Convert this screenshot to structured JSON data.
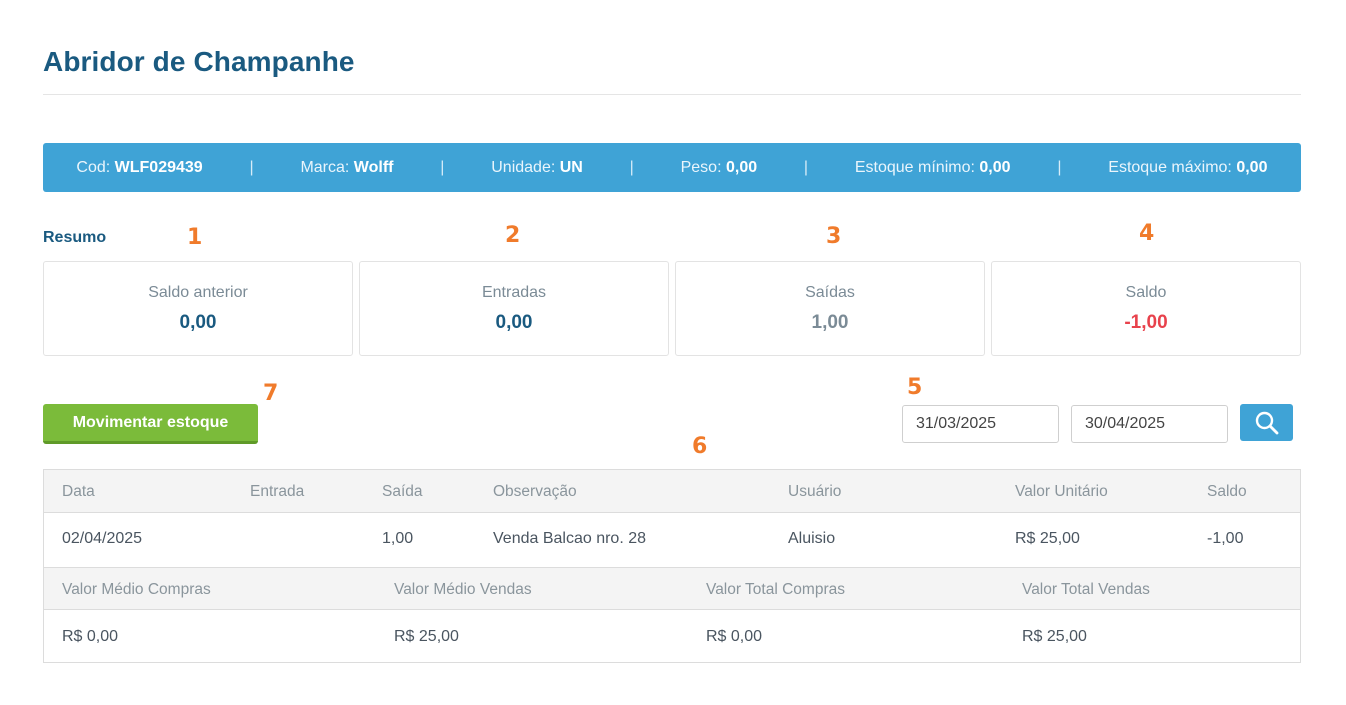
{
  "page": {
    "title": "Abridor de Champanhe"
  },
  "info": {
    "cod_label": "Cod:",
    "cod_value": "WLF029439",
    "marca_label": "Marca:",
    "marca_value": "Wolff",
    "unidade_label": "Unidade:",
    "unidade_value": "UN",
    "peso_label": "Peso:",
    "peso_value": "0,00",
    "min_label": "Estoque mínimo:",
    "min_value": "0,00",
    "max_label": "Estoque máximo:",
    "max_value": "0,00",
    "separator": "|"
  },
  "resumo": {
    "label": "Resumo",
    "cards": [
      {
        "label": "Saldo anterior",
        "value": "0,00",
        "color": "#1a5a80"
      },
      {
        "label": "Entradas",
        "value": "0,00",
        "color": "#1a5a80"
      },
      {
        "label": "Saídas",
        "value": "1,00",
        "color": "#7b8b96"
      },
      {
        "label": "Saldo",
        "value": "-1,00",
        "color": "#e8424c"
      }
    ]
  },
  "markers": [
    "1",
    "2",
    "3",
    "4",
    "5",
    "6",
    "7"
  ],
  "actions": {
    "move_stock": "Movimentar estoque",
    "search_icon": "search-icon"
  },
  "filters": {
    "date_from": "31/03/2025",
    "date_to": "30/04/2025"
  },
  "movements": {
    "headers": [
      "Data",
      "Entrada",
      "Saída",
      "Observação",
      "Usuário",
      "Valor Unitário",
      "Saldo"
    ],
    "rows": [
      {
        "data": "02/04/2025",
        "entrada": "",
        "saida": "1,00",
        "observacao": "Venda Balcao nro. 28",
        "usuario": "Aluisio",
        "valor_unitario": "R$ 25,00",
        "saldo": "-1,00"
      }
    ]
  },
  "totals": {
    "headers": [
      "Valor Médio Compras",
      "Valor Médio Vendas",
      "Valor Total Compras",
      "Valor Total Vendas"
    ],
    "values": [
      "R$ 0,00",
      "R$ 25,00",
      "R$ 0,00",
      "R$ 25,00"
    ]
  },
  "colors": {
    "accent": "#3fa3d6",
    "primary_text": "#1a5a80",
    "button_green": "#7bbb3a",
    "marker_orange": "#f07b2b",
    "negative": "#e8424c"
  }
}
